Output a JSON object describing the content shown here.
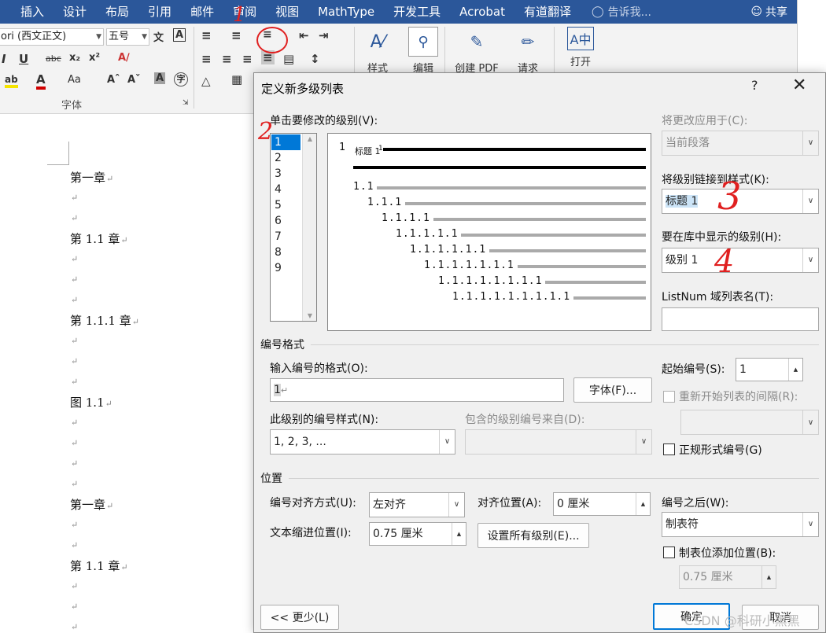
{
  "ribbon": {
    "tabs": [
      "插入",
      "设计",
      "布局",
      "引用",
      "邮件",
      "审阅",
      "视图",
      "MathType",
      "开发工具",
      "Acrobat",
      "有道翻译"
    ],
    "tell_me": "告诉我...",
    "share": "共享",
    "font_name": "ori (西文正文)",
    "font_size": "五号",
    "font_group_label": "字体",
    "styles_label": "样式",
    "edit_label": "编辑",
    "create_pdf_label": "创建 PDF",
    "request_label": "请求",
    "open_label": "打开"
  },
  "document": {
    "lines": [
      {
        "text": "第一章",
        "pm": "↵"
      },
      {
        "text": "",
        "pm": "↵"
      },
      {
        "text": "",
        "pm": "↵"
      },
      {
        "text": "第 1.1 章",
        "pm": "↵"
      },
      {
        "text": "",
        "pm": "↵"
      },
      {
        "text": "",
        "pm": "↵"
      },
      {
        "text": "",
        "pm": "↵"
      },
      {
        "text": "第 1.1.1 章",
        "pm": "↵"
      },
      {
        "text": "",
        "pm": "↵"
      },
      {
        "text": "",
        "pm": "↵"
      },
      {
        "text": "",
        "pm": "↵"
      },
      {
        "text": "图 1.1",
        "pm": "↵"
      },
      {
        "text": "",
        "pm": "↵"
      },
      {
        "text": "",
        "pm": "↵"
      },
      {
        "text": "",
        "pm": "↵"
      },
      {
        "text": "",
        "pm": "↵"
      },
      {
        "text": "第一章",
        "pm": "↵"
      },
      {
        "text": "",
        "pm": "↵"
      },
      {
        "text": "",
        "pm": "↵"
      },
      {
        "text": "第 1.1 章",
        "pm": "↵"
      },
      {
        "text": "",
        "pm": "↵"
      },
      {
        "text": "",
        "pm": "↵"
      },
      {
        "text": "",
        "pm": "↵"
      }
    ]
  },
  "dialog": {
    "title": "定义新多级列表",
    "help": "?",
    "close": "✕",
    "click_level_label": "单击要修改的级别(V):",
    "levels": [
      "1",
      "2",
      "3",
      "4",
      "5",
      "6",
      "7",
      "8",
      "9"
    ],
    "selected_level": "1",
    "preview": {
      "heading_text": "标题 1",
      "rows": [
        "1",
        "1.1",
        "1.1.1",
        "1.1.1.1",
        "1.1.1.1.1",
        "1.1.1.1.1.1",
        "1.1.1.1.1.1.1",
        "1.1.1.1.1.1.1.1",
        "1.1.1.1.1.1.1.1.1"
      ]
    },
    "apply_to_label": "将更改应用于(C):",
    "apply_to_value": "当前段落",
    "link_style_label": "将级别链接到样式(K):",
    "link_style_value": "标题 1",
    "gallery_level_label": "要在库中显示的级别(H):",
    "gallery_level_value": "级别 1",
    "listnum_label": "ListNum 域列表名(T):",
    "listnum_value": "",
    "number_format_section": "编号格式",
    "enter_format_label": "输入编号的格式(O):",
    "enter_format_value": "1",
    "font_button": "字体(F)...",
    "number_style_label": "此级别的编号样式(N):",
    "number_style_value": "1, 2, 3, ...",
    "include_level_label": "包含的级别编号来自(D):",
    "include_level_value": "",
    "start_at_label": "起始编号(S):",
    "start_at_value": "1",
    "restart_label": "重新开始列表的间隔(R):",
    "restart_value": "",
    "legal_label": "正规形式编号(G)",
    "position_section": "位置",
    "alignment_label": "编号对齐方式(U):",
    "alignment_value": "左对齐",
    "aligned_at_label": "对齐位置(A):",
    "aligned_at_value": "0 厘米",
    "indent_label": "文本缩进位置(I):",
    "indent_value": "0.75 厘米",
    "set_all_button": "设置所有级别(E)...",
    "follow_label": "编号之后(W):",
    "follow_value": "制表符",
    "tab_stop_label": "制表位添加位置(B):",
    "tab_stop_value": "0.75 厘米",
    "less_button": "<< 更少(L)",
    "ok_button": "确定",
    "cancel_button": "取消"
  },
  "annotations": [
    "1",
    "2",
    "3",
    "4"
  ],
  "watermark": "CSDN @科研小黑黑",
  "colors": {
    "ribbon_blue": "#2b579a",
    "selection_blue": "#0078d7",
    "annotation_red": "#e02020"
  }
}
